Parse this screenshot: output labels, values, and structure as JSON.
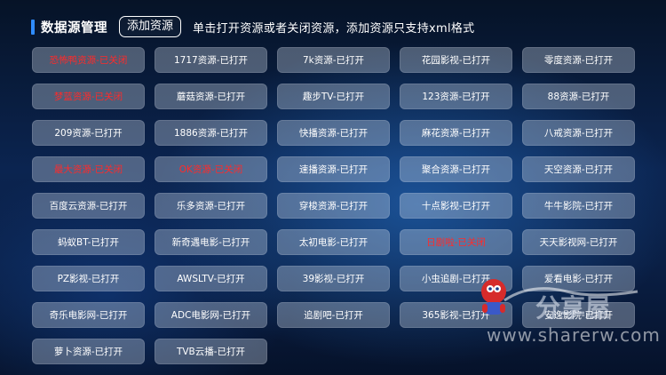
{
  "header": {
    "title": "数据源管理",
    "add_button_label": "添加资源",
    "hint": "单击打开资源或者关闭资源，添加资源只支持xml格式"
  },
  "colors": {
    "accent": "#2f8cff",
    "closed_text": "#ff2a2a",
    "open_text": "#ffffff"
  },
  "sources": [
    {
      "label": "恐怖鸭资源-已关闭",
      "status": "closed"
    },
    {
      "label": "1717资源-已打开",
      "status": "open"
    },
    {
      "label": "7k资源-已打开",
      "status": "open"
    },
    {
      "label": "花园影视-已打开",
      "status": "open"
    },
    {
      "label": "零度资源-已打开",
      "status": "open"
    },
    {
      "label": "梦蓝资源-已关闭",
      "status": "closed"
    },
    {
      "label": "蘑菇资源-已打开",
      "status": "open"
    },
    {
      "label": "趣步TV-已打开",
      "status": "open"
    },
    {
      "label": "123资源-已打开",
      "status": "open"
    },
    {
      "label": "88资源-已打开",
      "status": "open"
    },
    {
      "label": "209资源-已打开",
      "status": "open"
    },
    {
      "label": "1886资源-已打开",
      "status": "open"
    },
    {
      "label": "快播资源-已打开",
      "status": "open"
    },
    {
      "label": "麻花资源-已打开",
      "status": "open"
    },
    {
      "label": "八戒资源-已打开",
      "status": "open"
    },
    {
      "label": "最大资源-已关闭",
      "status": "closed"
    },
    {
      "label": "OK资源-已关闭",
      "status": "closed"
    },
    {
      "label": "速播资源-已打开",
      "status": "open"
    },
    {
      "label": "聚合资源-已打开",
      "status": "open"
    },
    {
      "label": "天空资源-已打开",
      "status": "open"
    },
    {
      "label": "百度云资源-已打开",
      "status": "open"
    },
    {
      "label": "乐多资源-已打开",
      "status": "open"
    },
    {
      "label": "穿梭资源-已打开",
      "status": "open"
    },
    {
      "label": "十点影视-已打开",
      "status": "open"
    },
    {
      "label": "牛牛影院-已打开",
      "status": "open"
    },
    {
      "label": "蚂蚁BT-已打开",
      "status": "open"
    },
    {
      "label": "新奇遇电影-已打开",
      "status": "open"
    },
    {
      "label": "太初电影-已打开",
      "status": "open"
    },
    {
      "label": "日剧啦-已关闭",
      "status": "closed"
    },
    {
      "label": "天天影视网-已打开",
      "status": "open"
    },
    {
      "label": "PZ影视-已打开",
      "status": "open"
    },
    {
      "label": "AWSLTV-已打开",
      "status": "open"
    },
    {
      "label": "39影视-已打开",
      "status": "open"
    },
    {
      "label": "小虫追剧-已打开",
      "status": "open"
    },
    {
      "label": "爱看电影-已打开",
      "status": "open"
    },
    {
      "label": "奇乐电影网-已打开",
      "status": "open"
    },
    {
      "label": "ADC电影网-已打开",
      "status": "open"
    },
    {
      "label": "追剧吧-已打开",
      "status": "open"
    },
    {
      "label": "365影视-已打开",
      "status": "open"
    },
    {
      "label": "安逸影院-已打开",
      "status": "open"
    },
    {
      "label": "萝卜资源-已打开",
      "status": "open"
    },
    {
      "label": "TVB云播-已打开",
      "status": "open"
    }
  ],
  "watermark": {
    "text": "www.sharerw.com",
    "logo_text": "分享屋"
  }
}
